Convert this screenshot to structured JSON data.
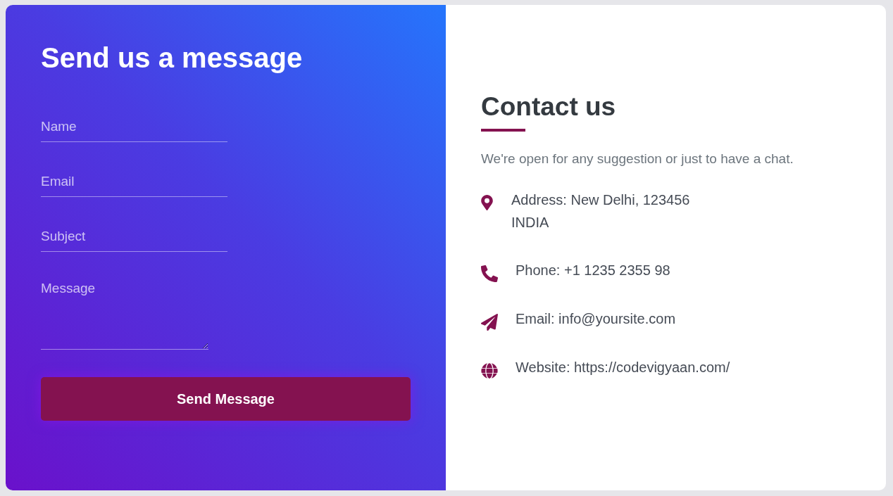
{
  "form": {
    "title": "Send us a message",
    "fields": [
      {
        "kind": "input",
        "placeholder": "Name"
      },
      {
        "kind": "input",
        "placeholder": "Email"
      },
      {
        "kind": "input",
        "placeholder": "Subject"
      },
      {
        "kind": "textarea",
        "placeholder": "Message"
      }
    ],
    "button": "Send Message"
  },
  "contact": {
    "title": "Contact us",
    "tagline": "We're open for any suggestion or just to have a chat.",
    "items": [
      {
        "kind": "address",
        "lines": [
          "Address: New Delhi, 123456",
          "INDIA"
        ]
      },
      {
        "kind": "phone",
        "lines": [
          "Phone: +1 1235 2355 98"
        ]
      },
      {
        "kind": "email",
        "lines": [
          "Email: info@yoursite.com"
        ]
      },
      {
        "kind": "website",
        "lines": [
          "Website: https://codevigyaan.com/"
        ]
      }
    ]
  }
}
